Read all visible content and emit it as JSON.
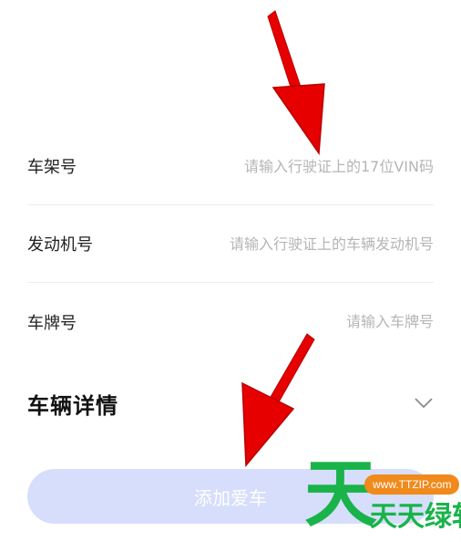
{
  "form": {
    "vin": {
      "label": "车架号",
      "placeholder": "请输入行驶证上的17位VIN码"
    },
    "engine": {
      "label": "发动机号",
      "placeholder": "请输入行驶证上的车辆发动机号"
    },
    "plate": {
      "label": "车牌号",
      "placeholder": "请输入车牌号"
    }
  },
  "details": {
    "title": "车辆详情",
    "icon": "chevron-down-icon"
  },
  "submit": {
    "label": "添加爱车"
  },
  "annotations": {
    "arrow_color": "#ee0000"
  },
  "watermark": {
    "logo_char": "天",
    "url": "www.TTZIP.com",
    "text": "天天绿软"
  }
}
